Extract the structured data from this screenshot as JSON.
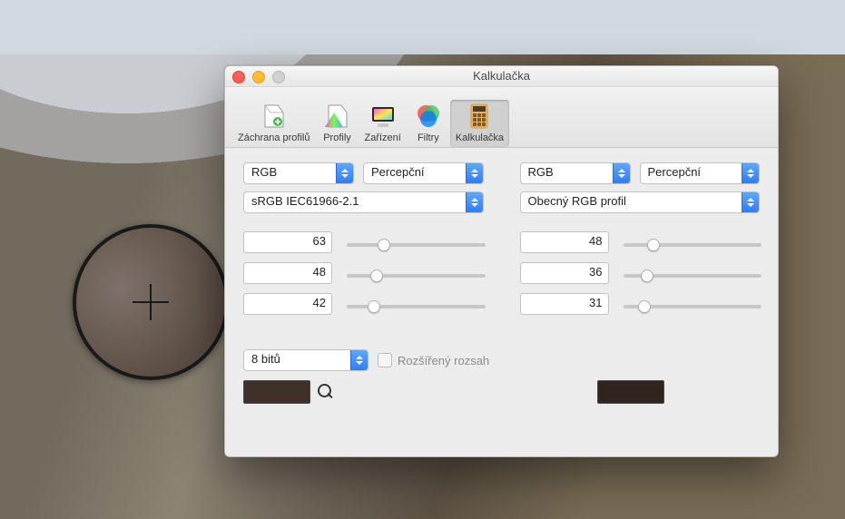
{
  "window": {
    "title": "Kalkulačka"
  },
  "toolbar": {
    "items": [
      {
        "id": "profile-first-aid",
        "label": "Záchrana profilů"
      },
      {
        "id": "profiles",
        "label": "Profily"
      },
      {
        "id": "devices",
        "label": "Zařízení"
      },
      {
        "id": "filters",
        "label": "Filtry"
      },
      {
        "id": "calculator",
        "label": "Kalkulačka"
      }
    ],
    "selected_index": 4
  },
  "left": {
    "color_space": "RGB",
    "intent": "Percepční",
    "profile": "sRGB IEC61966-2.1",
    "channels": [
      63,
      48,
      42
    ],
    "slider_max": 255,
    "swatch_hex": "#3f302a"
  },
  "right": {
    "color_space": "RGB",
    "intent": "Percepční",
    "profile": "Obecný RGB profil",
    "channels": [
      48,
      36,
      31
    ],
    "slider_max": 255,
    "swatch_hex": "#30241f"
  },
  "bit_depth": {
    "value": "8 bitů"
  },
  "extended_range": {
    "label": "Rozšířený rozsah",
    "checked": false
  }
}
